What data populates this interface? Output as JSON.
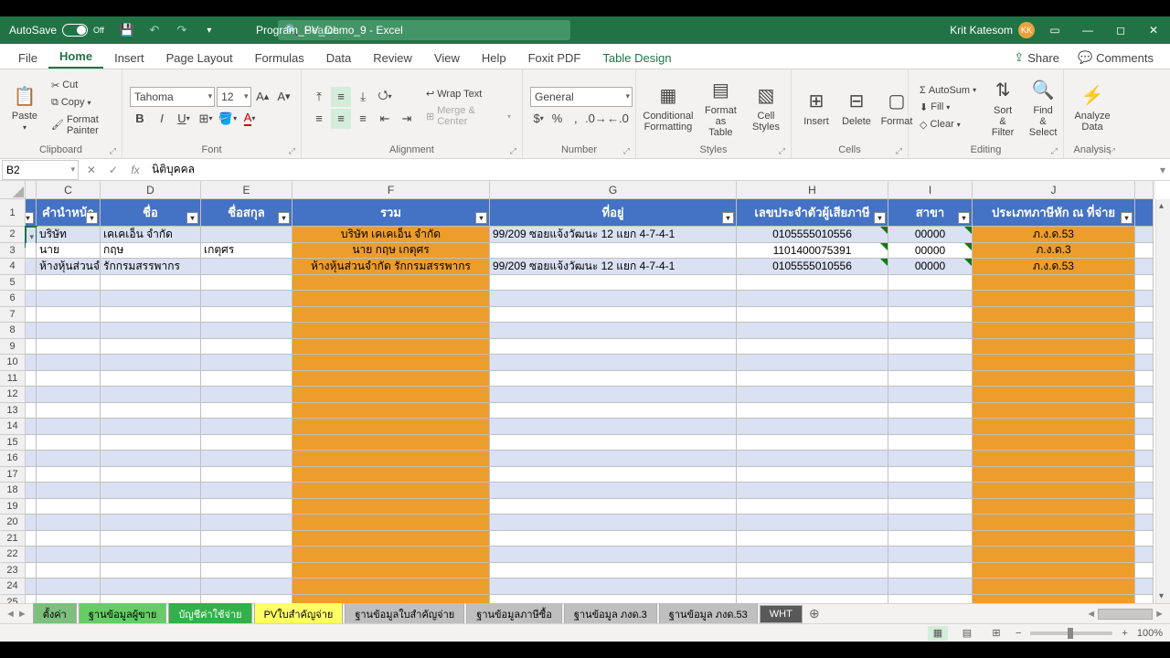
{
  "titlebar": {
    "autosave_label": "AutoSave",
    "autosave_state": "Off",
    "doc_title": "Program_PV_Demo_9 - Excel",
    "search_placeholder": "Search",
    "user_name": "Krit Katesom",
    "user_initials": "KK"
  },
  "tabs": [
    "File",
    "Home",
    "Insert",
    "Page Layout",
    "Formulas",
    "Data",
    "Review",
    "View",
    "Help",
    "Foxit PDF",
    "Table Design"
  ],
  "active_tab": "Home",
  "share": "Share",
  "comments": "Comments",
  "ribbon": {
    "clipboard": {
      "paste": "Paste",
      "cut": "Cut",
      "copy": "Copy",
      "fp": "Format Painter",
      "label": "Clipboard"
    },
    "font": {
      "name": "Tahoma",
      "size": "12",
      "label": "Font"
    },
    "alignment": {
      "wrap": "Wrap Text",
      "merge": "Merge & Center",
      "label": "Alignment"
    },
    "number": {
      "format": "General",
      "label": "Number"
    },
    "styles": {
      "cf": "Conditional\nFormatting",
      "fat": "Format as\nTable",
      "cs": "Cell\nStyles",
      "label": "Styles"
    },
    "cells": {
      "ins": "Insert",
      "del": "Delete",
      "fmt": "Format",
      "label": "Cells"
    },
    "editing": {
      "sum": "AutoSum",
      "fill": "Fill",
      "clear": "Clear",
      "sort": "Sort &\nFilter",
      "find": "Find &\nSelect",
      "label": "Editing"
    },
    "analysis": {
      "ad": "Analyze\nData",
      "label": "Analysis"
    }
  },
  "namebox": "B2",
  "formula": "นิติบุคคล",
  "col_letters": [
    "",
    "C",
    "D",
    "E",
    "F",
    "G",
    "H",
    "I",
    "J",
    ""
  ],
  "headers": [
    "คำนำหน้า",
    "ชื่อ",
    "ชื่อสกุล",
    "รวม",
    "ที่อยู่",
    "เลขประจำตัวผู้เสียภาษี",
    "สาขา",
    "ประเภทภาษีหัก ณ ที่จ่าย"
  ],
  "rows": [
    {
      "c": "บริษัท",
      "d": "เคเคเอ็น จำกัด",
      "e": "",
      "f": "บริษัท เคเคเอ็น จำกัด",
      "g": "99/209 ซอยแจ้งวัฒนะ 12 แยก 4-7-4-1",
      "h": "0105555010556",
      "i": "00000",
      "j": "ภ.ง.ด.53"
    },
    {
      "c": "นาย",
      "d": "กฤษ",
      "e": "เกตุศร",
      "f": "นาย กฤษ เกตุศร",
      "g": "",
      "h": "1101400075391",
      "i": "00000",
      "j": "ภ.ง.ด.3"
    },
    {
      "c": "ห้างหุ้นส่วนจำกัด",
      "d": "รักกรมสรรพากร",
      "e": "",
      "f": "ห้างหุ้นส่วนจำกัด รักกรมสรรพากร",
      "g": "99/209 ซอยแจ้งวัฒนะ 12 แยก 4-7-4-1",
      "h": "0105555010556",
      "i": "00000",
      "j": "ภ.ง.ด.53"
    }
  ],
  "sheet_tabs": [
    "ตั้งค่า",
    "ฐานข้อมูลผู้ขาย",
    "บัญชีค่าใช้จ่าย",
    "PVใบสำคัญจ่าย",
    "ฐานข้อมูลใบสำคัญจ่าย",
    "ฐานข้อมูลภาษีซื้อ",
    "ฐานข้อมูล ภงด.3",
    "ฐานข้อมูล ภงด.53",
    "WHT"
  ],
  "zoom": "100%"
}
